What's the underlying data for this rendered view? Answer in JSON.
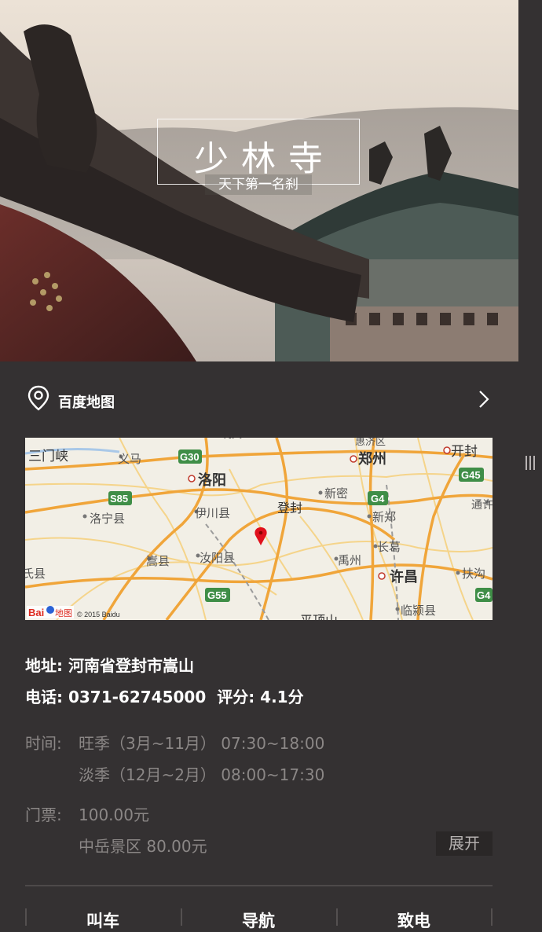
{
  "hero": {
    "title": "少林寺",
    "subtitle": "天下第一名刹"
  },
  "map_row": {
    "label": "百度地图",
    "left_icon": "location-pin-icon",
    "right_icon": "chevron-right-icon"
  },
  "map": {
    "places": [
      "三门峡",
      "义马",
      "洛阳",
      "郑州",
      "开封",
      "新密",
      "新郑",
      "洛宁县",
      "伊川县",
      "登封",
      "嵩县",
      "汝阳县",
      "禹州",
      "长葛",
      "许昌",
      "扶沟",
      "临颍县",
      "通许",
      "平顶山",
      "氏县",
      "惠济区",
      "巩义"
    ],
    "roads": [
      "G30",
      "S85",
      "G4",
      "G45",
      "G55",
      "G4"
    ],
    "logo": "Bai",
    "logo2": "地图",
    "copyright": "© 2015 Baidu"
  },
  "info": {
    "address_label": "地址:",
    "address": "河南省登封市嵩山",
    "phone_label": "电话:",
    "phone": "0371-62745000",
    "rating_label": "评分:",
    "rating": "4.1分",
    "time_label": "时间:",
    "time_peak": "旺季（3月~11月） 07:30~18:00",
    "time_off": "淡季（12月~2月） 08:00~17:30",
    "ticket_label": "门票:",
    "ticket_price": "100.00元",
    "ticket_extra": "中岳景区 80.00元",
    "expand": "展开"
  },
  "actions": {
    "taxi": "叫车",
    "navigate": "导航",
    "call": "致电"
  },
  "colors": {
    "background": "#343132",
    "muted_text": "#8b8786",
    "map_marker": "#e0101c"
  }
}
